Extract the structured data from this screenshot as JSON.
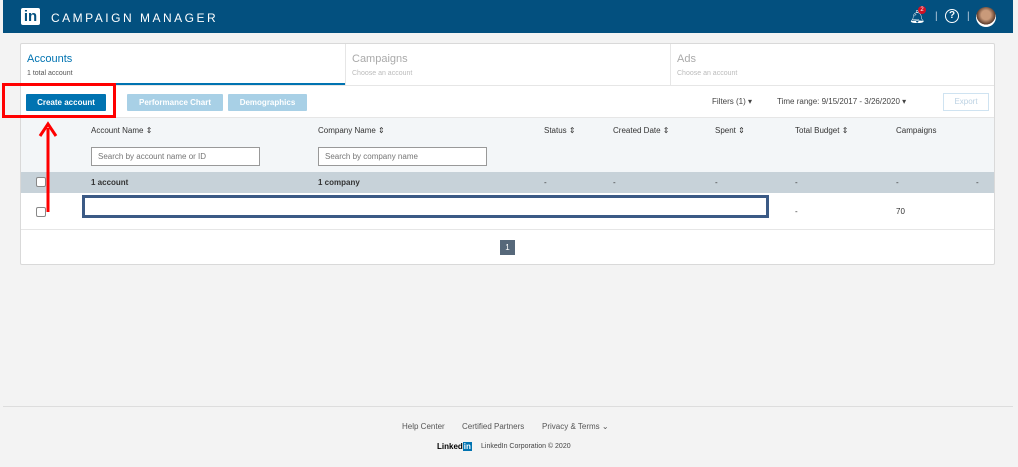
{
  "header": {
    "title": "CAMPAIGN MANAGER",
    "logo": "in",
    "notifications": "2"
  },
  "tabs": [
    {
      "label": "Accounts",
      "sub": "1 total account"
    },
    {
      "label": "Campaigns",
      "sub": "Choose an account"
    },
    {
      "label": "Ads",
      "sub": "Choose an account"
    }
  ],
  "toolbar": {
    "create": "Create account",
    "performance": "Performance Chart",
    "demographics": "Demographics",
    "filters": "Filters (1) ▾",
    "time_range": "Time range: 9/15/2017 - 3/26/2020 ▾",
    "export": "Export"
  },
  "table": {
    "columns": [
      "Account Name ⇕",
      "Company Name ⇕",
      "Status ⇕",
      "Created Date ⇕",
      "Spent ⇕",
      "Total Budget ⇕",
      "Campaigns"
    ],
    "account_placeholder": "Search by account name or ID",
    "company_placeholder": "Search by company name",
    "summary": [
      "1 account",
      "1 company",
      "-",
      "-",
      "-",
      "-",
      "-",
      "-"
    ],
    "row": {
      "total_budget": "-",
      "campaigns": "70"
    }
  },
  "pagination": {
    "page": "1"
  },
  "footer": {
    "links": [
      "Help Center",
      "Certified Partners",
      "Privacy & Terms ⌄"
    ],
    "brand": "Linkedin",
    "copyright": "LinkedIn Corporation © 2020"
  },
  "colors": {
    "header": "#03507f",
    "accent": "#0073b1",
    "annotation": "#ff0000"
  }
}
